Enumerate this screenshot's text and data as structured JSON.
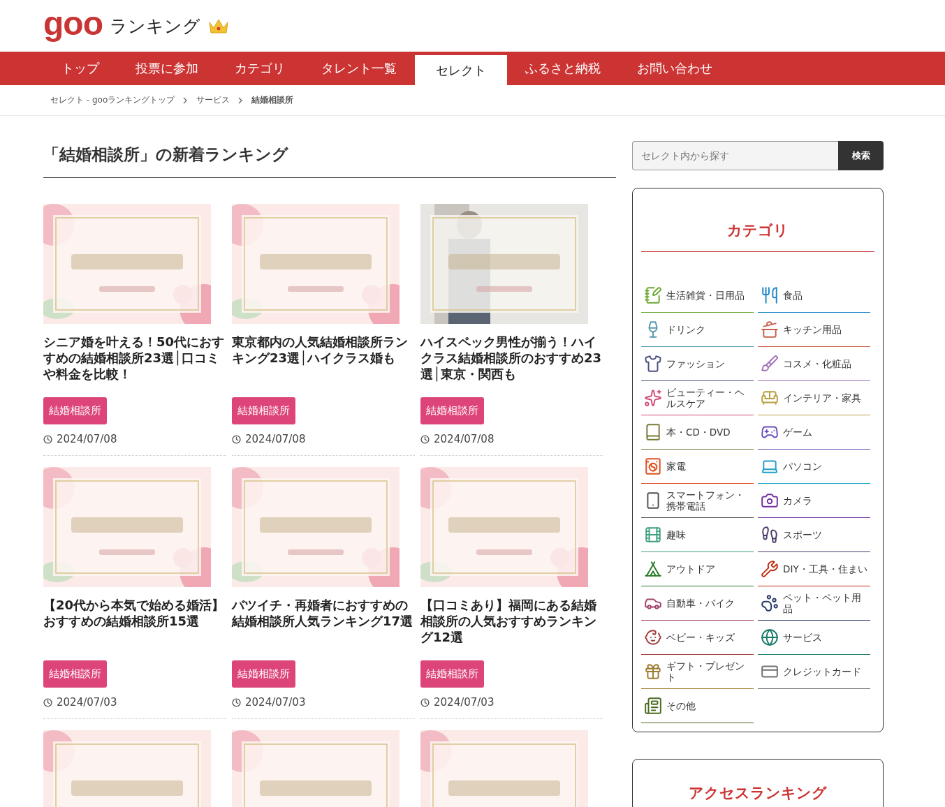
{
  "logo": {
    "mark": "goo",
    "text": "ランキング"
  },
  "nav": [
    {
      "label": "トップ",
      "selected": false
    },
    {
      "label": "投票に参加",
      "selected": false
    },
    {
      "label": "カテゴリ",
      "selected": false
    },
    {
      "label": "タレント一覧",
      "selected": false
    },
    {
      "label": "セレクト",
      "selected": true
    },
    {
      "label": "ふるさと納税",
      "selected": false
    },
    {
      "label": "お問い合わせ",
      "selected": false
    }
  ],
  "breadcrumb": [
    "セレクト - gooランキングトップ",
    "サービス",
    "結婚相談所"
  ],
  "heading": "「結婚相談所」の新着ランキング",
  "articles": [
    {
      "title": "シニア婚を叶える！50代におすすめの結婚相談所23選│口コミや料金を比較！",
      "tag": "結婚相談所",
      "date": "2024/07/08"
    },
    {
      "title": "東京都内の人気結婚相談所ランキング23選│ハイクラス婚も",
      "tag": "結婚相談所",
      "date": "2024/07/08"
    },
    {
      "title": "ハイスペック男性が揃う！ハイクラス結婚相談所のおすすめ23選│東京・関西も",
      "tag": "結婚相談所",
      "date": "2024/07/08"
    },
    {
      "title": "【20代から本気で始める婚活】おすすめの結婚相談所15選",
      "tag": "結婚相談所",
      "date": "2024/07/03"
    },
    {
      "title": "バツイチ・再婚者におすすめの結婚相談所人気ランキング17選",
      "tag": "結婚相談所",
      "date": "2024/07/03"
    },
    {
      "title": "【口コミあり】福岡にある結婚相談所の人気おすすめランキング12選",
      "tag": "結婚相談所",
      "date": "2024/07/03"
    }
  ],
  "search": {
    "placeholder": "セレクト内から探す",
    "button": "検索"
  },
  "categories": {
    "title": "カテゴリ",
    "items": [
      {
        "label": "生活雑貨・日用品",
        "color": "#6aa832"
      },
      {
        "label": "食品",
        "color": "#1e88c8"
      },
      {
        "label": "ドリンク",
        "color": "#5a9ab0"
      },
      {
        "label": "キッチン用品",
        "color": "#c8604a"
      },
      {
        "label": "ファッション",
        "color": "#4a5080"
      },
      {
        "label": "コスメ・化粧品",
        "color": "#a070b8"
      },
      {
        "label": "ビューティー・ヘルスケア",
        "color": "#d04a7a"
      },
      {
        "label": "インテリア・家具",
        "color": "#b8a040"
      },
      {
        "label": "本・CD・DVD",
        "color": "#7a7a3a"
      },
      {
        "label": "ゲーム",
        "color": "#6a50c0"
      },
      {
        "label": "家電",
        "color": "#e05020"
      },
      {
        "label": "パソコン",
        "color": "#20a0c8"
      },
      {
        "label": "スマートフォン・携帯電話",
        "color": "#505050"
      },
      {
        "label": "カメラ",
        "color": "#7030a0"
      },
      {
        "label": "趣味",
        "color": "#40a080"
      },
      {
        "label": "スポーツ",
        "color": "#4a3a6a"
      },
      {
        "label": "アウトドア",
        "color": "#2a7a2a"
      },
      {
        "label": "DIY・工具・住まい",
        "color": "#c02a10"
      },
      {
        "label": "自動車・バイク",
        "color": "#a0406a"
      },
      {
        "label": "ペット・ペット用品",
        "color": "#2a3a6a"
      },
      {
        "label": "ベビー・キッズ",
        "color": "#a03a3a"
      },
      {
        "label": "サービス",
        "color": "#1a7a6a"
      },
      {
        "label": "ギフト・プレゼント",
        "color": "#a07a30"
      },
      {
        "label": "クレジットカード",
        "color": "#707070"
      },
      {
        "label": "その他",
        "color": "#4a6a20"
      }
    ]
  },
  "access_ranking": {
    "title": "アクセスランキング"
  }
}
